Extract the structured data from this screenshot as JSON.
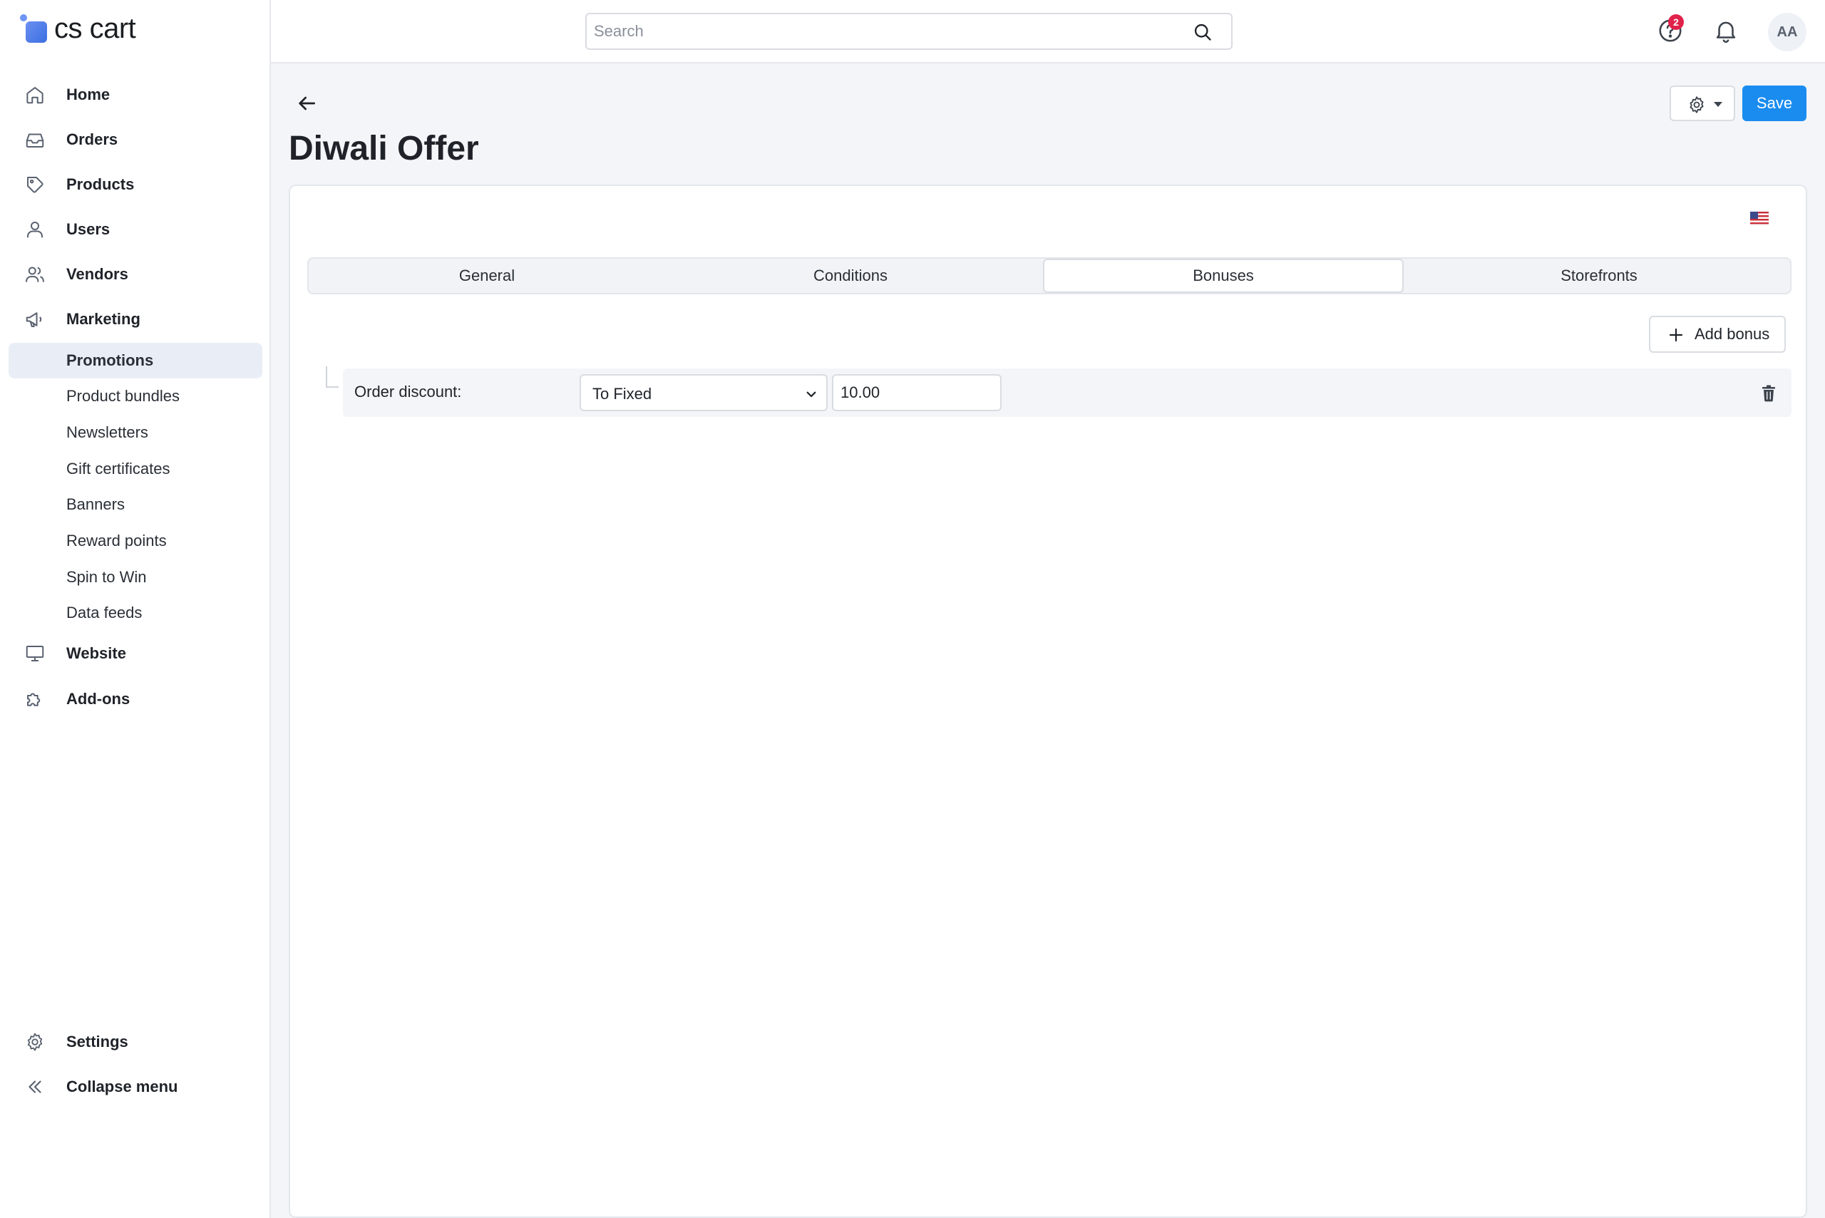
{
  "brand": {
    "name": "cs cart",
    "icon": "cs-cart-logo-icon"
  },
  "sidebar": {
    "items": [
      {
        "label": "Home",
        "icon": "home-icon"
      },
      {
        "label": "Orders",
        "icon": "inbox-icon"
      },
      {
        "label": "Products",
        "icon": "tag-icon"
      },
      {
        "label": "Users",
        "icon": "user-icon"
      },
      {
        "label": "Vendors",
        "icon": "users-icon"
      },
      {
        "label": "Marketing",
        "icon": "megaphone-icon"
      }
    ],
    "marketing_sub": [
      {
        "label": "Promotions",
        "active": true
      },
      {
        "label": "Product bundles"
      },
      {
        "label": "Newsletters"
      },
      {
        "label": "Gift certificates"
      },
      {
        "label": "Banners"
      },
      {
        "label": "Reward points"
      },
      {
        "label": "Spin to Win"
      },
      {
        "label": "Data feeds"
      }
    ],
    "items_after": [
      {
        "label": "Website",
        "icon": "monitor-icon"
      },
      {
        "label": "Add-ons",
        "icon": "puzzle-icon"
      }
    ],
    "footer": [
      {
        "label": "Settings",
        "icon": "gear-icon"
      },
      {
        "label": "Collapse menu",
        "icon": "double-chevron-left-icon"
      }
    ]
  },
  "topbar": {
    "search_placeholder": "Search",
    "help_badge": "2",
    "avatar_initials": "AA"
  },
  "page": {
    "title": "Diwali Offer",
    "save_label": "Save",
    "language_flag": "us-flag-icon"
  },
  "tabs": [
    {
      "label": "General"
    },
    {
      "label": "Conditions"
    },
    {
      "label": "Bonuses",
      "active": true
    },
    {
      "label": "Storefronts"
    }
  ],
  "bonuses": {
    "add_label": "Add bonus",
    "rows": [
      {
        "label": "Order discount:",
        "type": "To Fixed",
        "value": "10.00"
      }
    ]
  },
  "colors": {
    "accent": "#1a8cf0",
    "badge": "#e0224a",
    "active_nav": "#e9eef6",
    "background": "#f3f5f9"
  }
}
